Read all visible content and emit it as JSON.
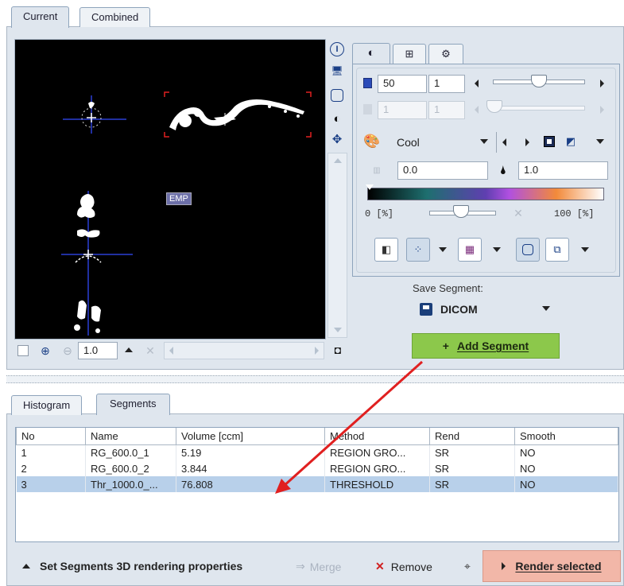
{
  "top_tabs": [
    "Current",
    "Combined"
  ],
  "viewer": {
    "overlay_label": "EMP",
    "zoom_value": "1.0"
  },
  "side_tabs": [
    "contrast-tab",
    "layout-tab",
    "settings-tab"
  ],
  "controls": {
    "upper_value": "50",
    "upper_frame": "1",
    "lower_value": "1",
    "lower_frame": "1",
    "colormap": "Cool",
    "min_value": "0.0",
    "max_value": "1.0",
    "range_min_label": "0 [%]",
    "range_max_label": "100 [%]"
  },
  "save_segment": {
    "label": "Save Segment:",
    "format": "DICOM",
    "add_button": "Add Segment",
    "add_prefix": "+"
  },
  "bottom_tabs": [
    "Histogram",
    "Segments"
  ],
  "segments_table": {
    "columns": [
      "No",
      "Name",
      "Volume [ccm]",
      "Method",
      "Rend",
      "Smooth"
    ],
    "rows": [
      [
        "1",
        "RG_600.0_1",
        "5.19",
        "REGION GRO...",
        "SR",
        "NO"
      ],
      [
        "2",
        "RG_600.0_2",
        "3.844",
        "REGION GRO...",
        "SR",
        "NO"
      ],
      [
        "3",
        "Thr_1000.0_...",
        "76.808",
        "THRESHOLD",
        "SR",
        "NO"
      ]
    ],
    "selected_row": 3
  },
  "footer": {
    "set_props": "Set Segments 3D rendering properties",
    "merge": "Merge",
    "remove": "Remove",
    "render_selected": "Render selected"
  },
  "colors": {
    "accent_green": "#8cc84b",
    "render_button": "#f2b7a8",
    "annotation_arrow": "#e02020",
    "selected_row": "#b8d0ea"
  }
}
